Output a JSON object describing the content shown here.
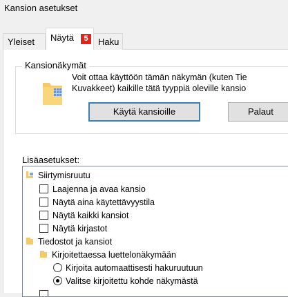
{
  "window": {
    "title": "Kansion asetukset"
  },
  "tabs": [
    {
      "label": "Yleiset"
    },
    {
      "label": "Näytä"
    },
    {
      "label": "Haku"
    }
  ],
  "badge": {
    "text": "5"
  },
  "folder_views": {
    "legend": "Kansionäkymät",
    "description_line1": "Voit ottaa käyttöön tämän näkymän (kuten Tie",
    "description_line2": "Kuvakkeet) kaikille tätä tyyppiä oleville kansio",
    "apply_label": "Käytä kansioille",
    "reset_label": "Palaut"
  },
  "advanced": {
    "label": "Lisäasetukset:",
    "items": [
      {
        "label": "Siirtymisruutu"
      },
      {
        "label": "Laajenna ja avaa kansio"
      },
      {
        "label": "Näytä aina käytettävyystila"
      },
      {
        "label": "Näytä kaikki kansiot"
      },
      {
        "label": "Näytä kirjastot"
      },
      {
        "label": "Tiedostot ja kansiot"
      },
      {
        "label": "Kirjoitettaessa luettelonäkymään"
      },
      {
        "label": "Kirjoita automaattisesti hakuruutuun"
      },
      {
        "label": "Valitse kirjoitettu kohde näkymästä"
      }
    ]
  },
  "colors": {
    "accent": "#3c7fb1",
    "badge": "#e2231a",
    "folder": "#f5c96a"
  }
}
